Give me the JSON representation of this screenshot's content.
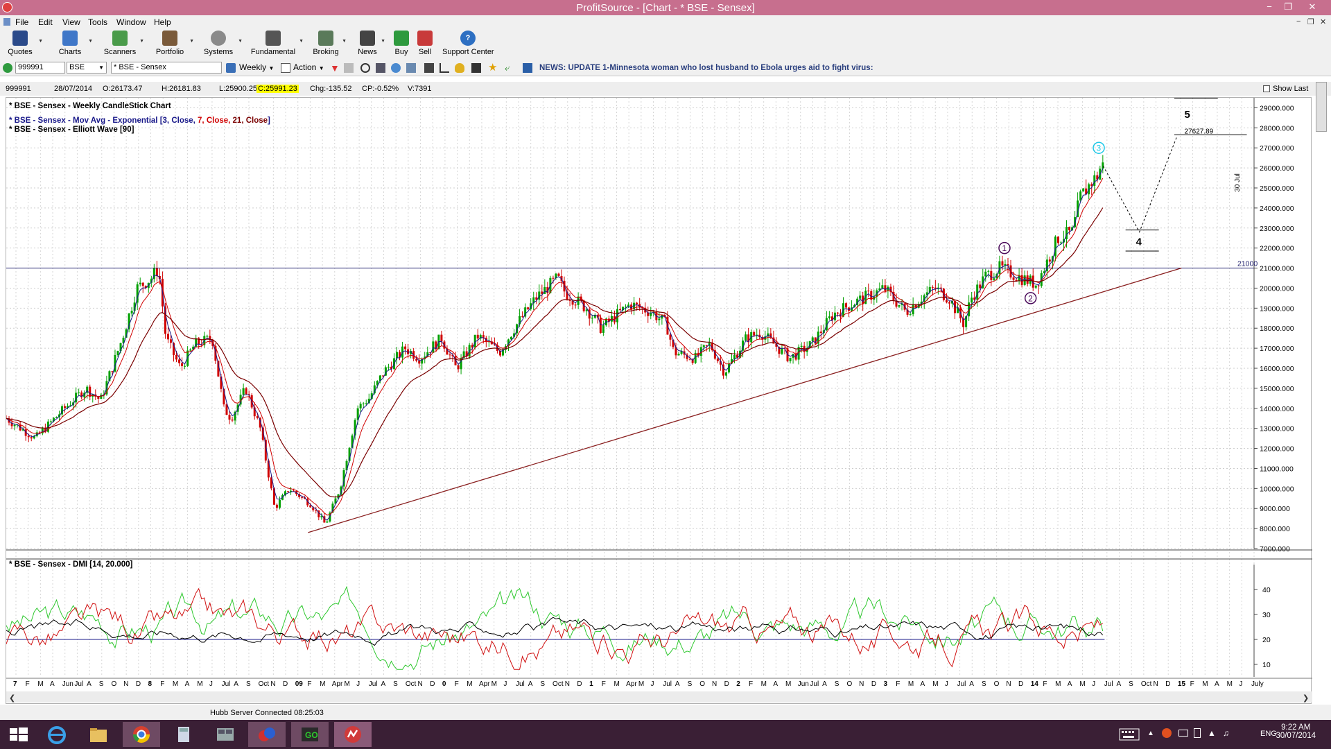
{
  "window": {
    "title": "ProfitSource - [Chart - * BSE - Sensex]",
    "min": "−",
    "max": "❐",
    "close": "✕"
  },
  "menu": [
    "File",
    "Edit",
    "View",
    "Tools",
    "Window",
    "Help"
  ],
  "toolbar": [
    {
      "label": "Quotes",
      "icon": "quotes-icon",
      "color": "#2b4a8a"
    },
    {
      "label": "Charts",
      "icon": "charts-icon",
      "color": "#3f77c8"
    },
    {
      "label": "Scanners",
      "icon": "scanners-icon",
      "color": "#4a9b4a"
    },
    {
      "label": "Portfolio",
      "icon": "portfolio-icon",
      "color": "#7a5a3a"
    },
    {
      "label": "Systems",
      "icon": "systems-icon",
      "color": "#8a8a8a"
    },
    {
      "label": "Fundamental",
      "icon": "fundamental-icon",
      "color": "#555555"
    },
    {
      "label": "Broking",
      "icon": "broking-icon",
      "color": "#5a7a5a"
    },
    {
      "label": "News",
      "icon": "news-icon",
      "color": "#444444"
    },
    {
      "label": "Buy",
      "icon": "buy-icon",
      "color": "#2e9a3e"
    },
    {
      "label": "Sell",
      "icon": "sell-icon",
      "color": "#c83a3a"
    },
    {
      "label": "Support Center",
      "icon": "help-icon",
      "color": "#2d6fc2"
    }
  ],
  "toolbar2": {
    "code": "999991",
    "exchange": "BSE",
    "security": "* BSE - Sensex",
    "period": "Weekly",
    "action": "Action",
    "news": "NEWS: UPDATE 1-Minnesota woman who lost husband to Ebola urges aid to fight virus:"
  },
  "infobar": {
    "code": "999991",
    "date": "28/07/2014",
    "open": "O:26173.47",
    "high": "H:26181.83",
    "low": "L:25900.25",
    "close": "C:25991.23",
    "change": "Chg:-135.52",
    "change_pct": "CP:-0.52%",
    "volume": "V:7391",
    "show_last": "Show Last"
  },
  "legend": {
    "title": "* BSE - Sensex - Weekly CandleStick Chart",
    "ma_prefix": "* BSE - Sensex - Mov Avg - Exponential [",
    "ma_p1": "3, Close, ",
    "ma_p2": "7, Close, ",
    "ma_p3": "21, Close",
    "ma_suffix": "]",
    "elliott": "* BSE - Sensex - Elliott Wave [90]",
    "dmi": "* BSE - Sensex - DMI [14, 20.000]"
  },
  "annotations": {
    "level_label": "21000",
    "target_label": "27627.89",
    "date_label": "30 Jul",
    "wave1": "1",
    "wave2": "2",
    "wave3": "3",
    "wave4": "4",
    "wave5": "5"
  },
  "status": "Hubb Server Connected 08:25:03",
  "clock": {
    "time": "9:22 AM",
    "date": "30/07/2014"
  },
  "lang": "ENG",
  "colors": {
    "up": "#00a000",
    "down": "#d00000",
    "ma3": "#1a1a8a",
    "ma7": "#d00000",
    "ma21": "#7a0000",
    "dmi_plus": "#2ec82e",
    "dmi_minus": "#d01010",
    "adx": "#000000",
    "level": "#1a1a6a"
  },
  "chart_data": [
    {
      "type": "candlestick",
      "title": "* BSE - Sensex - Weekly CandleStick Chart",
      "timeframe": "weekly",
      "x_range": [
        "2007-01",
        "2015-07"
      ],
      "ylim": [
        7000,
        29500
      ],
      "y_ticks": [
        "29000.000",
        "28000.000",
        "27000.000",
        "26000.000",
        "25000.000",
        "24000.000",
        "23000.000",
        "22000.000",
        "21000.000",
        "20000.000",
        "19000.000",
        "18000.000",
        "17000.000",
        "16000.000",
        "15000.000",
        "14000.000",
        "13000.000",
        "12000.000",
        "11000.000",
        "10000.000",
        "9000.000",
        "8000.000",
        "7000.000"
      ],
      "x_ticks": [
        "7",
        "F",
        "M",
        "A",
        "Jun",
        "Jul",
        "A",
        "S",
        "O",
        "N",
        "D",
        "8",
        "F",
        "M",
        "A",
        "M",
        "J",
        "Jul",
        "A",
        "S",
        "Oct",
        "N",
        "D",
        "09",
        "F",
        "M",
        "Apr",
        "M",
        "J",
        "Jul",
        "A",
        "S",
        "Oct",
        "N",
        "D",
        "0",
        "F",
        "M",
        "Apr",
        "M",
        "J",
        "Jul",
        "A",
        "S",
        "Oct",
        "N",
        "D",
        "1",
        "F",
        "M",
        "Apr",
        "M",
        "J",
        "Jul",
        "A",
        "S",
        "O",
        "N",
        "D",
        "2",
        "F",
        "M",
        "A",
        "M",
        "Jun",
        "Jul",
        "A",
        "S",
        "O",
        "N",
        "D",
        "3",
        "F",
        "M",
        "A",
        "M",
        "J",
        "Jul",
        "A",
        "S",
        "O",
        "N",
        "D",
        "14",
        "F",
        "M",
        "A",
        "M",
        "J",
        "Jul",
        "A",
        "S",
        "Oct",
        "N",
        "D",
        "15",
        "F",
        "M",
        "A",
        "M",
        "J",
        "July"
      ],
      "price_path": [
        [
          2007.0,
          13500
        ],
        [
          2007.2,
          12500
        ],
        [
          2007.4,
          14000
        ],
        [
          2007.55,
          15000
        ],
        [
          2007.65,
          14400
        ],
        [
          2007.8,
          17500
        ],
        [
          2007.9,
          20000
        ],
        [
          2008.0,
          20500
        ],
        [
          2008.05,
          21000
        ],
        [
          2008.1,
          17500
        ],
        [
          2008.2,
          16000
        ],
        [
          2008.3,
          17200
        ],
        [
          2008.42,
          17500
        ],
        [
          2008.5,
          14000
        ],
        [
          2008.55,
          13500
        ],
        [
          2008.65,
          15000
        ],
        [
          2008.75,
          13000
        ],
        [
          2008.8,
          11000
        ],
        [
          2008.85,
          9000
        ],
        [
          2008.95,
          10000
        ],
        [
          2009.1,
          9200
        ],
        [
          2009.2,
          8200
        ],
        [
          2009.3,
          10000
        ],
        [
          2009.42,
          14000
        ],
        [
          2009.5,
          14500
        ],
        [
          2009.6,
          15800
        ],
        [
          2009.75,
          17000
        ],
        [
          2009.85,
          16500
        ],
        [
          2010.0,
          17500
        ],
        [
          2010.1,
          16000
        ],
        [
          2010.25,
          17600
        ],
        [
          2010.4,
          16800
        ],
        [
          2010.5,
          18000
        ],
        [
          2010.65,
          19500
        ],
        [
          2010.8,
          20500
        ],
        [
          2010.85,
          19800
        ],
        [
          2011.0,
          19000
        ],
        [
          2011.1,
          18000
        ],
        [
          2011.3,
          19200
        ],
        [
          2011.45,
          18800
        ],
        [
          2011.55,
          18200
        ],
        [
          2011.6,
          16800
        ],
        [
          2011.75,
          16500
        ],
        [
          2011.85,
          17200
        ],
        [
          2011.95,
          15800
        ],
        [
          2012.1,
          17500
        ],
        [
          2012.2,
          17800
        ],
        [
          2012.4,
          16500
        ],
        [
          2012.55,
          17200
        ],
        [
          2012.7,
          18700
        ],
        [
          2012.85,
          19300
        ],
        [
          2013.0,
          19800
        ],
        [
          2013.05,
          20000
        ],
        [
          2013.2,
          18800
        ],
        [
          2013.3,
          19500
        ],
        [
          2013.4,
          20000
        ],
        [
          2013.5,
          19500
        ],
        [
          2013.6,
          18200
        ],
        [
          2013.65,
          19500
        ],
        [
          2013.75,
          20600
        ],
        [
          2013.85,
          21000
        ],
        [
          2014.0,
          20500
        ],
        [
          2014.1,
          20200
        ],
        [
          2014.25,
          22500
        ],
        [
          2014.35,
          22800
        ],
        [
          2014.4,
          24500
        ],
        [
          2014.48,
          25300
        ],
        [
          2014.52,
          25600
        ],
        [
          2014.55,
          26200
        ],
        [
          2014.57,
          25991
        ]
      ]
    },
    {
      "type": "line",
      "title": "* BSE - Sensex - DMI [14, 20.000]",
      "ylim": [
        5,
        50
      ],
      "y_ticks": [
        "40",
        "30",
        "20",
        "10"
      ],
      "threshold": 20,
      "series": []
    }
  ]
}
